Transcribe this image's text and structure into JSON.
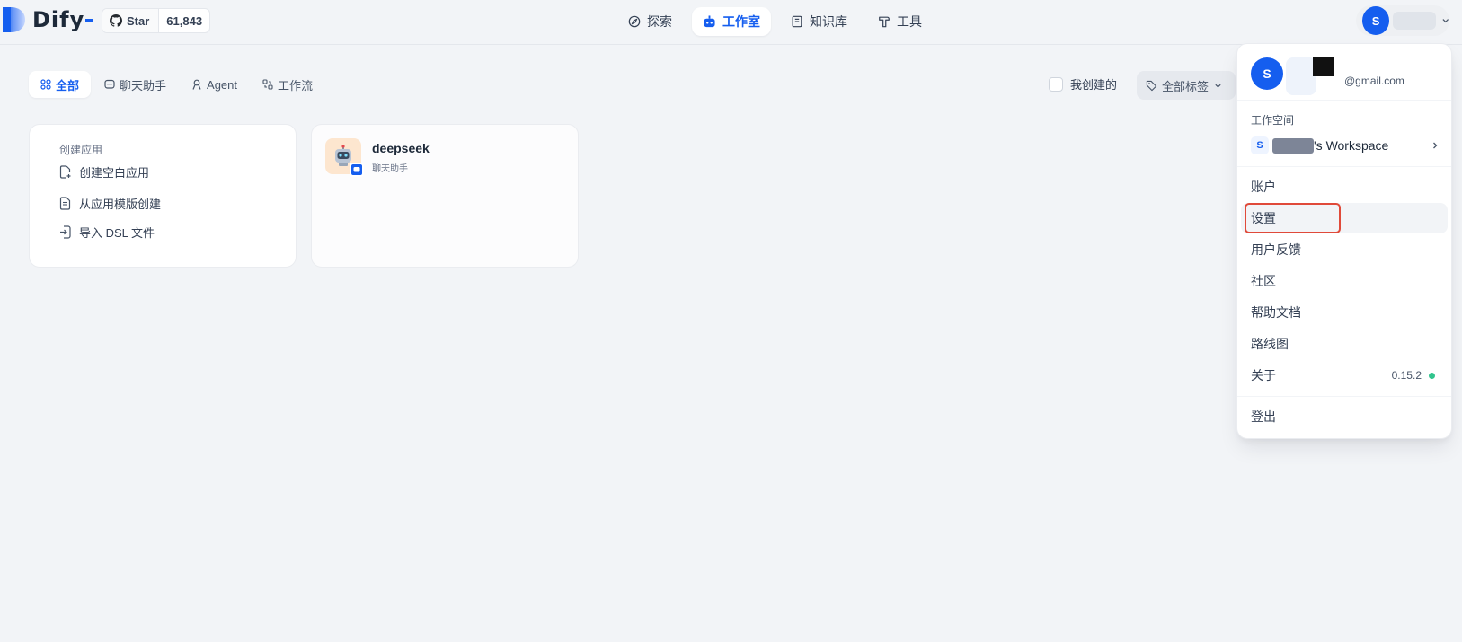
{
  "brand": {
    "name": "Dify"
  },
  "github": {
    "label": "Star",
    "count": "61,843"
  },
  "nav": {
    "items": [
      {
        "label": "探索",
        "icon": "explore-icon"
      },
      {
        "label": "工作室",
        "icon": "robot-icon",
        "active": true
      },
      {
        "label": "知识库",
        "icon": "book-icon"
      },
      {
        "label": "工具",
        "icon": "hammer-icon"
      }
    ]
  },
  "user": {
    "initial": "S"
  },
  "filters": {
    "tabs": [
      {
        "label": "全部",
        "active": true
      },
      {
        "label": "聊天助手"
      },
      {
        "label": "Agent"
      },
      {
        "label": "工作流"
      }
    ],
    "mine_label": "我创建的",
    "tag_label": "全部标签"
  },
  "create_card": {
    "title": "创建应用",
    "items": [
      "创建空白应用",
      "从应用模版创建",
      "导入 DSL 文件"
    ]
  },
  "apps": [
    {
      "name": "deepseek",
      "type": "聊天助手"
    }
  ],
  "dropdown": {
    "avatar_initial": "S",
    "email_suffix": "@gmail.com",
    "workspace_title": "工作空间",
    "workspace_initial": "S",
    "workspace_suffix": "'s Workspace",
    "menu": [
      "账户",
      "设置",
      "用户反馈",
      "社区",
      "帮助文档",
      "路线图",
      "关于"
    ],
    "version": "0.15.2",
    "logout": "登出"
  },
  "colors": {
    "accent": "#155eef",
    "highlight": "#e04a3a",
    "status_ok": "#31c48d"
  }
}
